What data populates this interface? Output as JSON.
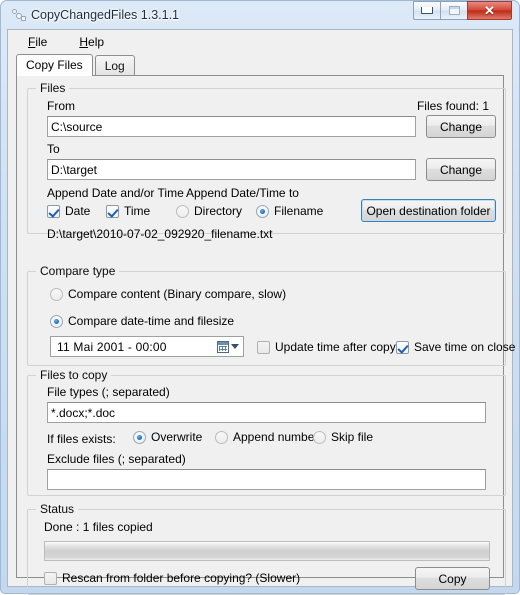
{
  "window": {
    "title": "CopyChangedFiles 1.3.1.1",
    "icon": "app-dots-icon",
    "controls": {
      "minimize": "minimize-icon",
      "maximize": "maximize-icon",
      "close": "✕"
    }
  },
  "menu": {
    "items": [
      {
        "accel": "F",
        "rest": "ile"
      },
      {
        "accel": "H",
        "rest": "elp"
      }
    ]
  },
  "tabs": [
    {
      "label": "Copy Files",
      "active": true
    },
    {
      "label": "Log",
      "active": false
    }
  ],
  "files_group": {
    "caption": "Files",
    "from_label": "From",
    "from_value": "C:\\source",
    "files_found_label": "Files found: 1",
    "to_label": "To",
    "to_value": "D:\\target",
    "change_from_label": "Change",
    "change_to_label": "Change",
    "append_datetime_label": "Append Date and/or Time",
    "append_target_label": "Append Date/Time to",
    "date_checkbox": {
      "label": "Date",
      "checked": true
    },
    "time_checkbox": {
      "label": "Time",
      "checked": true
    },
    "directory_radio": {
      "label": "Directory",
      "selected": false
    },
    "filename_radio": {
      "label": "Filename",
      "selected": true
    },
    "open_destination_label": "Open destination folder",
    "preview_path": "D:\\target\\2010-07-02_092920_filename.txt"
  },
  "compare_group": {
    "caption": "Compare type",
    "binary_radio": {
      "label": "Compare content (Binary compare, slow)",
      "selected": false
    },
    "datetime_radio": {
      "label": "Compare date-time and filesize",
      "selected": true
    },
    "date_value": "11  Mai   2001  -   00:00",
    "update_time_checkbox": {
      "label": "Update time after copy.",
      "checked": false
    },
    "save_time_checkbox": {
      "label": "Save time on close",
      "checked": true
    }
  },
  "copy_group": {
    "caption": "Files to copy",
    "file_types_label": "File types (; separated)",
    "file_types_value": "*.docx;*.doc",
    "if_exists_label": "If files exists:",
    "overwrite_radio": {
      "label": "Overwrite",
      "selected": true
    },
    "append_number_radio": {
      "label": "Append number",
      "selected": false
    },
    "skip_file_radio": {
      "label": "Skip file",
      "selected": false
    },
    "exclude_label": "Exclude files (; separated)",
    "exclude_value": ""
  },
  "status_group": {
    "caption": "Status",
    "status_text": "Done : 1 files copied",
    "progress_percent": 0,
    "rescan_checkbox": {
      "label": "Rescan from folder before copying? (Slower)",
      "checked": false
    },
    "copy_button_label": "Copy"
  }
}
